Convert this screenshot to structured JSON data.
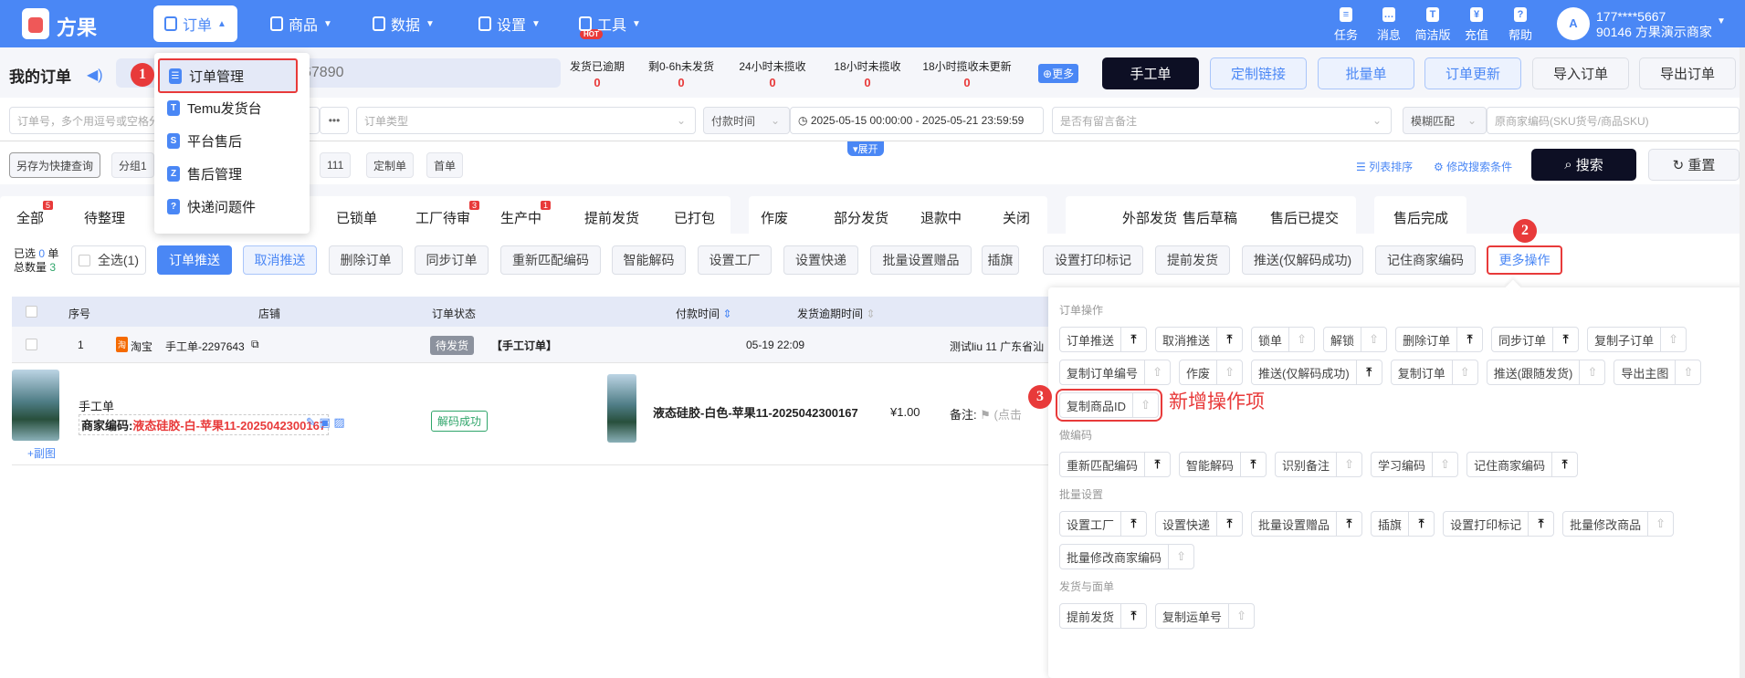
{
  "header": {
    "brand": "方果",
    "nav": [
      {
        "label": "订单",
        "active": true
      },
      {
        "label": "商品"
      },
      {
        "label": "数据"
      },
      {
        "label": "设置"
      },
      {
        "label": "工具",
        "badge": "HOT"
      }
    ],
    "right_icons": [
      {
        "label": "任务",
        "icon": "task-icon"
      },
      {
        "label": "消息",
        "icon": "message-icon"
      },
      {
        "label": "简洁版",
        "icon": "shirt-icon"
      },
      {
        "label": "充值",
        "icon": "yen-icon"
      },
      {
        "label": "帮助",
        "icon": "help-icon"
      }
    ],
    "user": {
      "phone": "177****5667",
      "account": "90146 方果演示商家"
    }
  },
  "page": {
    "title": "我的订单",
    "search_placeholder": "67890"
  },
  "stats": [
    {
      "label": "发货已逾期",
      "value": "0"
    },
    {
      "label": "剩0-6h未发货",
      "value": "0"
    },
    {
      "label": "24小时未揽收",
      "value": "0"
    },
    {
      "label": "18小时未揽收",
      "value": "0"
    },
    {
      "label": "18小时揽收未更新",
      "value": "0"
    }
  ],
  "more_label": "更多",
  "top_buttons": [
    "手工单",
    "定制链接",
    "批量单",
    "订单更新",
    "导入订单",
    "导出订单"
  ],
  "filters": {
    "order_no": "订单号，多个用逗号或空格分",
    "dots": "•••",
    "order_type": "订单类型",
    "time_type": "付款时间",
    "date_range": "2025-05-15 00:00:00  -  2025-05-21 23:59:59",
    "remark": "是否有留言备注",
    "match": "模糊匹配",
    "sku": "原商家编码(SKU货号/商品SKU)"
  },
  "expand_label": "展开",
  "quick": {
    "save": "另存为快捷查询",
    "groups": [
      "分组1",
      "111",
      "定制单",
      "首单"
    ],
    "sort": "列表排序",
    "modify": "修改搜索条件",
    "search": "搜索",
    "reset": "重置"
  },
  "tabs": [
    {
      "label": "全部",
      "badge": "5"
    },
    {
      "label": "待整理"
    },
    {
      "label": "已锁单"
    },
    {
      "label": "工厂待审",
      "badge": "3"
    },
    {
      "label": "生产中",
      "badge": "1"
    },
    {
      "label": "提前发货"
    },
    {
      "label": "已打包"
    },
    {
      "label": "作废"
    },
    {
      "label": "部分发货"
    },
    {
      "label": "退款中"
    },
    {
      "label": "关闭"
    },
    {
      "label": "外部发货"
    },
    {
      "label": "售后草稿"
    },
    {
      "label": "售后已提交"
    },
    {
      "label": "售后完成"
    }
  ],
  "selection": {
    "selected_label": "已选",
    "selected": "0",
    "unit": "单",
    "total_label": "总数量",
    "total": "3",
    "select_all": "全选(1)"
  },
  "actions": [
    "订单推送",
    "取消推送",
    "删除订单",
    "同步订单",
    "重新匹配编码",
    "智能解码",
    "设置工厂",
    "设置快递",
    "批量设置赠品",
    "插旗",
    "设置打印标记",
    "提前发货",
    "推送(仅解码成功)",
    "记住商家编码",
    "更多操作"
  ],
  "table": {
    "headers": [
      "序号",
      "店铺",
      "订单状态",
      "付款时间",
      "发货逾期时间"
    ],
    "row": {
      "index": "1",
      "platform": "淘宝",
      "platform_icon": "淘",
      "shop": "手工单-2297643",
      "status": "待发货",
      "type": "【手工订单】",
      "pay_time": "05-19 22:09",
      "address": "测试liu 11  广东省汕"
    },
    "item": {
      "name": "手工单",
      "code_label": "商家编码:",
      "code": "液态硅胶-白-苹果11-2025042300167",
      "decode": "解码成功",
      "add_image": "+副图",
      "product": "液态硅胶-白色-苹果11-2025042300167",
      "price": "¥1.00",
      "remark": "备注:",
      "remark_hint": "(点击"
    }
  },
  "order_menu": [
    {
      "label": "订单管理",
      "icon": "list-icon",
      "selected": true
    },
    {
      "label": "Temu发货台",
      "icon": "temu-icon"
    },
    {
      "label": "平台售后",
      "icon": "aftersale-icon"
    },
    {
      "label": "售后管理",
      "icon": "manage-icon"
    },
    {
      "label": "快递问题件",
      "icon": "question-icon"
    }
  ],
  "popover": {
    "sections": [
      {
        "title": "订单操作",
        "items": [
          {
            "label": "订单推送",
            "pinned": true
          },
          {
            "label": "取消推送",
            "pinned": true
          },
          {
            "label": "锁单",
            "pinned": false
          },
          {
            "label": "解锁",
            "pinned": false
          },
          {
            "label": "删除订单",
            "pinned": true
          },
          {
            "label": "同步订单",
            "pinned": true
          },
          {
            "label": "复制子订单",
            "pinned": false
          },
          {
            "label": "复制订单编号",
            "pinned": false
          },
          {
            "label": "作废",
            "pinned": false
          },
          {
            "label": "推送(仅解码成功)",
            "pinned": true
          },
          {
            "label": "复制订单",
            "pinned": false
          },
          {
            "label": "推送(跟随发货)",
            "pinned": false
          },
          {
            "label": "导出主图",
            "pinned": false
          },
          {
            "label": "复制商品ID",
            "pinned": false,
            "new": true
          }
        ]
      },
      {
        "title": "做编码",
        "items": [
          {
            "label": "重新匹配编码",
            "pinned": true
          },
          {
            "label": "智能解码",
            "pinned": true
          },
          {
            "label": "识别备注",
            "pinned": false
          },
          {
            "label": "学习编码",
            "pinned": false
          },
          {
            "label": "记住商家编码",
            "pinned": true
          }
        ]
      },
      {
        "title": "批量设置",
        "items": [
          {
            "label": "设置工厂",
            "pinned": true
          },
          {
            "label": "设置快递",
            "pinned": true
          },
          {
            "label": "批量设置赠品",
            "pinned": true
          },
          {
            "label": "插旗",
            "pinned": true
          },
          {
            "label": "设置打印标记",
            "pinned": true
          },
          {
            "label": "批量修改商品",
            "pinned": false
          },
          {
            "label": "批量修改商家编码",
            "pinned": false
          }
        ]
      },
      {
        "title": "发货与面单",
        "items": [
          {
            "label": "提前发货",
            "pinned": true
          },
          {
            "label": "复制运单号",
            "pinned": false
          }
        ]
      }
    ],
    "annotation": "新增操作项"
  },
  "callouts": [
    "1",
    "2",
    "3"
  ],
  "colors": {
    "primary": "#4a87f5",
    "danger": "#e83a3a",
    "dark": "#0d0f24"
  }
}
